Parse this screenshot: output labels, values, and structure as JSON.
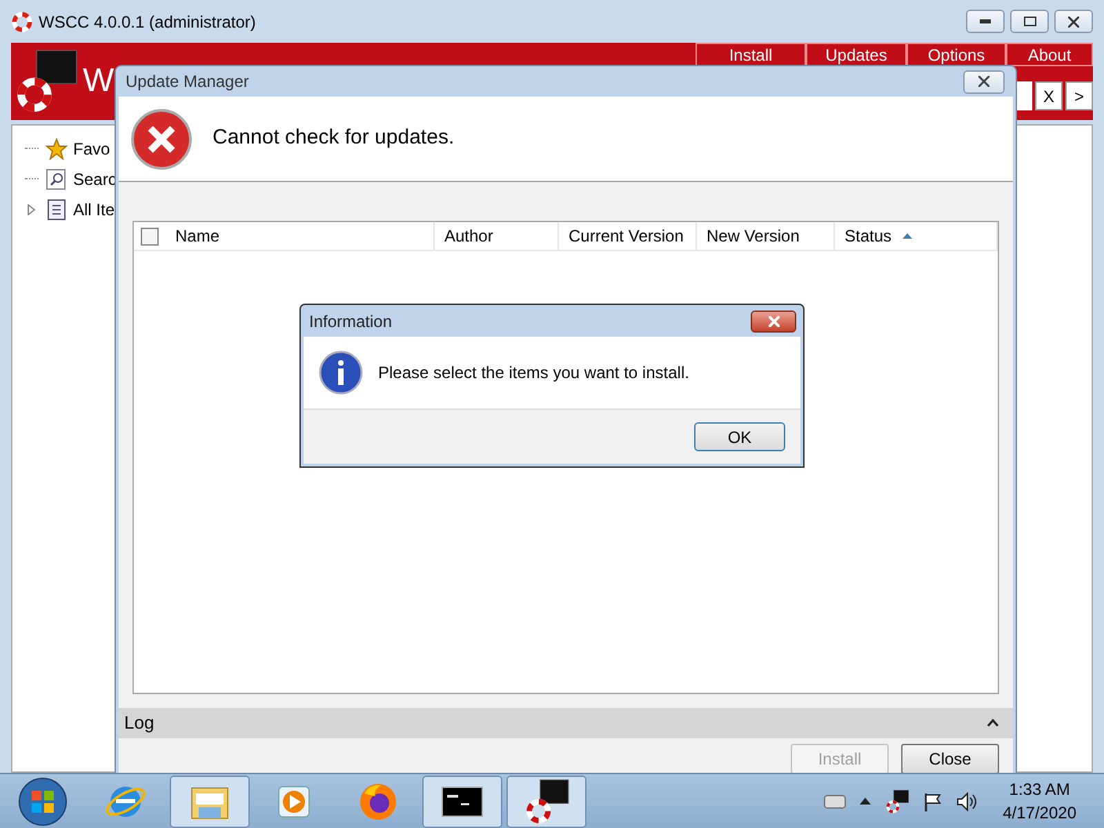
{
  "main_window": {
    "title": "WSCC 4.0.0.1 (administrator)",
    "header_title": "W",
    "menu": [
      {
        "label": "Install"
      },
      {
        "label": "Updates"
      },
      {
        "label": "Options"
      },
      {
        "label": "About"
      }
    ],
    "search_buttons": [
      "X",
      ">"
    ],
    "tree": [
      {
        "label": "Favo",
        "kind": "star",
        "expandable": false
      },
      {
        "label": "Searc",
        "kind": "search",
        "expandable": false
      },
      {
        "label": "All Ite",
        "kind": "page",
        "expandable": true
      }
    ]
  },
  "update_manager": {
    "title": "Update Manager",
    "message": "Cannot check for updates.",
    "select_all": {
      "checked": false
    },
    "columns": [
      {
        "label": "Name",
        "sorted": false
      },
      {
        "label": "Author",
        "sorted": false
      },
      {
        "label": "Current Version",
        "sorted": false
      },
      {
        "label": "New Version",
        "sorted": false
      },
      {
        "label": "Status",
        "sorted": true
      }
    ],
    "log": {
      "label": "Log",
      "expanded": false
    },
    "buttons": [
      {
        "label": "Install",
        "disabled": true
      },
      {
        "label": "Close",
        "disabled": false
      }
    ]
  },
  "info_dialog": {
    "title": "Information",
    "message": "Please select the items you want to install.",
    "button": "OK"
  },
  "taskbar": {
    "apps": [
      {
        "kind": "ie",
        "active": false
      },
      {
        "kind": "folder",
        "active": true
      },
      {
        "kind": "media",
        "active": false
      },
      {
        "kind": "firefox",
        "active": false
      },
      {
        "kind": "cmd",
        "active": true
      },
      {
        "kind": "wscc",
        "active": true
      }
    ],
    "time": "1:33 AM",
    "date": "4/17/2020"
  }
}
